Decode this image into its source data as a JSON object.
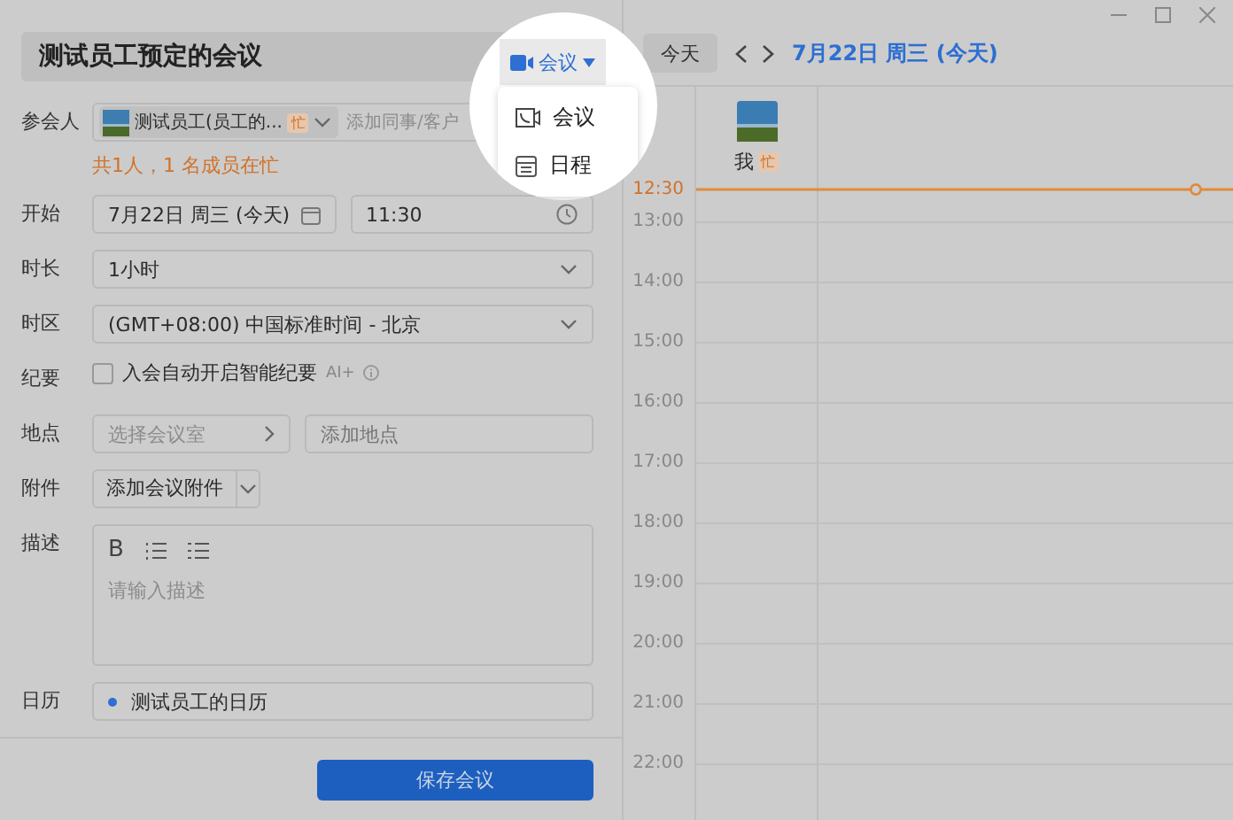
{
  "form": {
    "title": "测试员工预定的会议",
    "type_button": {
      "label": "会议"
    },
    "type_menu": [
      {
        "kind": "meeting",
        "label": "会议"
      },
      {
        "kind": "schedule",
        "label": "日程"
      }
    ],
    "rows": [
      {
        "kind": "attendees",
        "label": "参会人",
        "chip": {
          "name": "测试员工(员工的...",
          "badge": "忙"
        },
        "placeholder": "添加同事/客户",
        "note": "共1人，1 名成员在忙"
      },
      {
        "kind": "datetime",
        "label": "开始",
        "date": "7月22日 周三 (今天)",
        "time": "11:30"
      },
      {
        "kind": "select",
        "label": "时长",
        "value": "1小时"
      },
      {
        "kind": "select",
        "label": "时区",
        "value": "(GMT+08:00) 中国标准时间 - 北京"
      },
      {
        "kind": "checkbox",
        "label": "纪要",
        "text": "入会自动开启智能纪要",
        "tag": "AI+",
        "checked": false
      },
      {
        "kind": "location",
        "label": "地点",
        "room_placeholder": "选择会议室",
        "place_placeholder": "添加地点"
      },
      {
        "kind": "attachment",
        "label": "附件",
        "value": "添加会议附件"
      },
      {
        "kind": "description",
        "label": "描述",
        "bold": "B",
        "placeholder": "请输入描述"
      },
      {
        "kind": "calendar",
        "label": "日历",
        "value": "测试员工的日历"
      }
    ],
    "save_button": "保存会议"
  },
  "calendar": {
    "today_button": "今天",
    "date": "7月22日 周三 (今天)",
    "attendee": {
      "name": "我",
      "badge": "忙"
    },
    "now_time": "12:30",
    "hours": [
      "13:00",
      "14:00",
      "15:00",
      "16:00",
      "17:00",
      "18:00",
      "19:00",
      "20:00",
      "21:00",
      "22:00"
    ]
  }
}
